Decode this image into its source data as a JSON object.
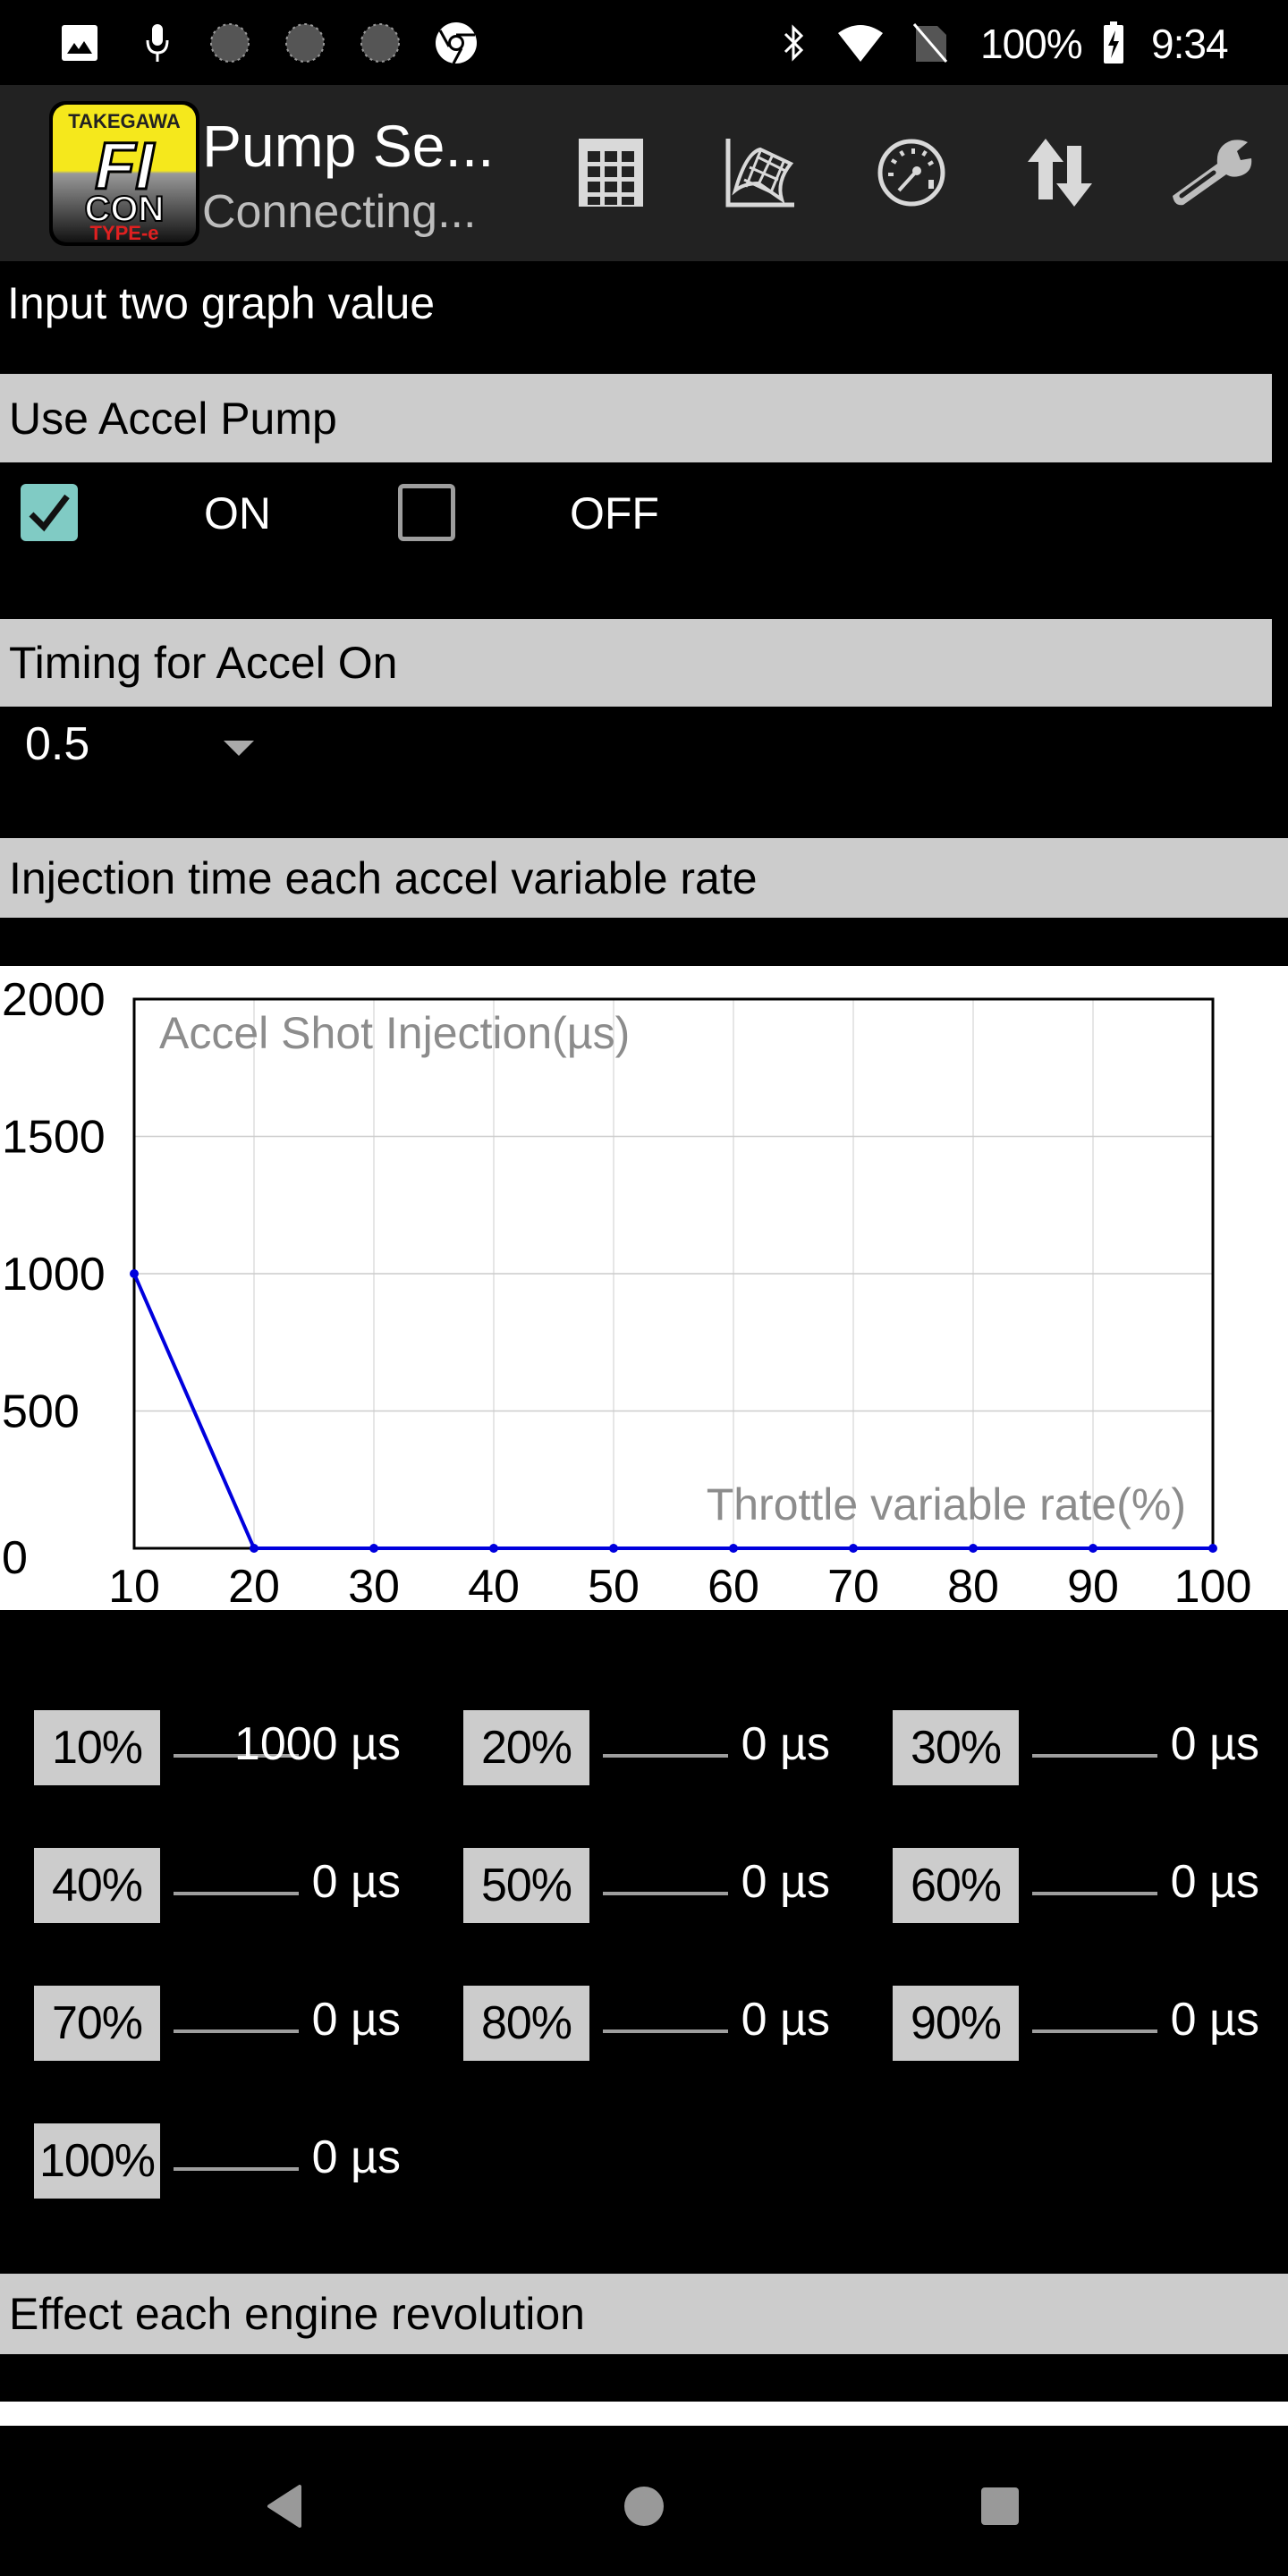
{
  "status_bar": {
    "left_icons": [
      "gallery-icon",
      "microphone-icon",
      "loading-icon",
      "loading-icon",
      "loading-icon",
      "chrome-icon"
    ],
    "right_icons": [
      "bluetooth-icon",
      "wifi-icon",
      "no-sim-icon"
    ],
    "battery": "100%",
    "time": "9:34"
  },
  "action_bar": {
    "logo": {
      "brand": "TAKEGAWA",
      "line1": "FI",
      "line2": "CON",
      "line3": "TYPE-e"
    },
    "title": "Pump Se...",
    "subtitle": "Connecting...",
    "actions": [
      {
        "name": "map-table",
        "icon": "grid-table-icon"
      },
      {
        "name": "map-3d-graph",
        "icon": "3d-graph-icon"
      },
      {
        "name": "gauge-monitor",
        "icon": "speedometer-icon"
      },
      {
        "name": "data-transfer",
        "icon": "up-down-arrows-icon"
      },
      {
        "name": "settings",
        "icon": "wrench-icon"
      }
    ]
  },
  "content": {
    "intro_label": "Input two graph value",
    "use_accel_pump": {
      "header": "Use Accel Pump",
      "options": [
        {
          "label": "ON",
          "checked": true
        },
        {
          "label": "OFF",
          "checked": false
        }
      ]
    },
    "timing": {
      "header": "Timing for Accel On",
      "selected": "0.5"
    },
    "injection": {
      "header": "Injection time each accel variable rate",
      "cells": [
        {
          "label": "10%",
          "value": "1000 µs"
        },
        {
          "label": "20%",
          "value": "0 µs"
        },
        {
          "label": "30%",
          "value": "0 µs"
        },
        {
          "label": "40%",
          "value": "0 µs"
        },
        {
          "label": "50%",
          "value": "0 µs"
        },
        {
          "label": "60%",
          "value": "0 µs"
        },
        {
          "label": "70%",
          "value": "0 µs"
        },
        {
          "label": "80%",
          "value": "0 µs"
        },
        {
          "label": "90%",
          "value": "0 µs"
        },
        {
          "label": "100%",
          "value": "0 µs"
        }
      ]
    },
    "effect_header": "Effect each engine revolution"
  },
  "colors": {
    "line": "#0000dd",
    "checkbox_accent": "#80cbc4",
    "header_bg": "#cccccc"
  },
  "chart_data": {
    "type": "line",
    "title": "Accel Shot Injection(µs)",
    "xlabel": "Throttle variable rate(%)",
    "ylabel": "",
    "x": [
      10,
      20,
      30,
      40,
      50,
      60,
      70,
      80,
      90,
      100
    ],
    "series": [
      {
        "name": "Accel Shot Injection",
        "values": [
          1000,
          0,
          0,
          0,
          0,
          0,
          0,
          0,
          0,
          0
        ]
      }
    ],
    "xlim": [
      10,
      100
    ],
    "ylim": [
      0,
      2000
    ],
    "xticks": [
      "10",
      "20",
      "30",
      "40",
      "50",
      "60",
      "70",
      "80",
      "90",
      "100"
    ],
    "yticks": [
      "0",
      "500",
      "1000",
      "1500",
      "2000"
    ],
    "grid": true,
    "legend": "none"
  },
  "nav_bar": {
    "buttons": [
      "back-icon",
      "home-icon",
      "recents-icon"
    ]
  }
}
